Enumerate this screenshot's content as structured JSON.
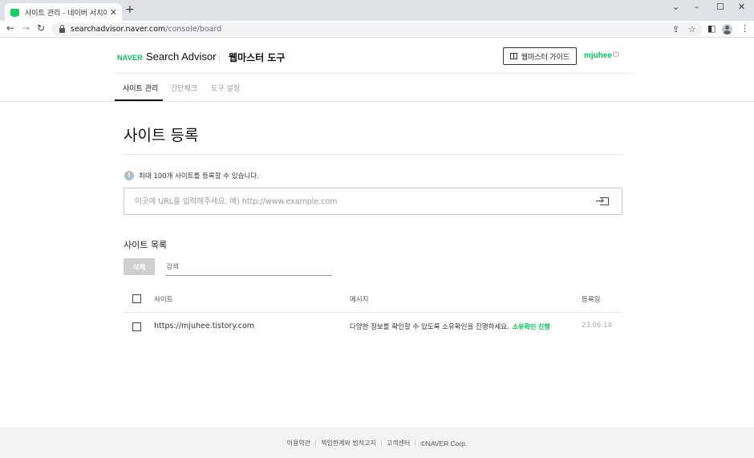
{
  "browser": {
    "tab_title": "사이트 관리 - 네이버 서치어드바이저",
    "tab_close": "✕",
    "new_tab": "+",
    "url_host": "searchadvisor.naver.com",
    "url_path": "/console/board"
  },
  "header": {
    "logo": "NAVER",
    "product": "Search Advisor",
    "tool_title": "웹마스터 도구",
    "guide_label": "웹마스터 가이드",
    "username": "mjuhee"
  },
  "nav": {
    "tabs": [
      {
        "label": "사이트 관리",
        "active": true
      },
      {
        "label": "간단체크",
        "active": false
      },
      {
        "label": "도구 설정",
        "active": false
      }
    ]
  },
  "main": {
    "title": "사이트 등록",
    "info": "최대 100개 사이트를 등록할 수 있습니다.",
    "url_placeholder": "이곳에 URL을 입력해주세요. 예) http://www.example.com",
    "list_title": "사이트 목록",
    "delete_label": "삭제",
    "search_placeholder": "검색",
    "columns": {
      "site": "사이트",
      "message": "메시지",
      "date": "등록일"
    },
    "rows": [
      {
        "site": "https://mjuhee.tistory.com",
        "message": "다양한 정보를 확인할 수 있도록 소유확인을 진행하세요.",
        "status": "소유확인 진행",
        "date": "23.06.14"
      }
    ]
  },
  "footer": {
    "links": [
      "이용약관",
      "책임한계와 법적고지",
      "고객센터"
    ],
    "copyright": "©NAVER Corp."
  },
  "colors": {
    "brand": "#03c75a",
    "text": "#222222",
    "muted": "#999999"
  }
}
